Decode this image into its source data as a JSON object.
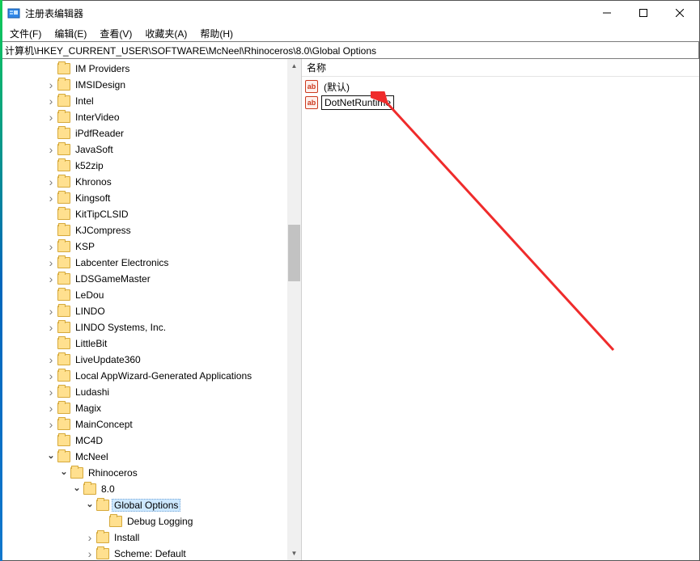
{
  "titlebar": {
    "title": "注册表编辑器"
  },
  "menubar": {
    "file": "文件(F)",
    "edit": "编辑(E)",
    "view": "查看(V)",
    "fav": "收藏夹(A)",
    "help": "帮助(H)"
  },
  "address": "计算机\\HKEY_CURRENT_USER\\SOFTWARE\\McNeel\\Rhinoceros\\8.0\\Global Options",
  "tree": {
    "flat_items": [
      "IM Providers",
      "IMSIDesign",
      "Intel",
      "InterVideo",
      "iPdfReader",
      "JavaSoft",
      "k52zip",
      "Khronos",
      "Kingsoft",
      "KitTipCLSID",
      "KJCompress",
      "KSP",
      "Labcenter Electronics",
      "LDSGameMaster",
      "LeDou",
      "LINDO",
      "LINDO Systems, Inc.",
      "LittleBit",
      "LiveUpdate360",
      "Local AppWizard-Generated Applications",
      "Ludashi",
      "Magix",
      "MainConcept",
      "MC4D"
    ],
    "mcneel": "McNeel",
    "rhino": "Rhinoceros",
    "v80": "8.0",
    "globalopts": "Global Options",
    "debuglog": "Debug Logging",
    "install": "Install",
    "scheme": "Scheme: Default"
  },
  "list": {
    "header_name": "名称",
    "default_value": "(默认)",
    "new_value": "DotNetRuntime"
  }
}
